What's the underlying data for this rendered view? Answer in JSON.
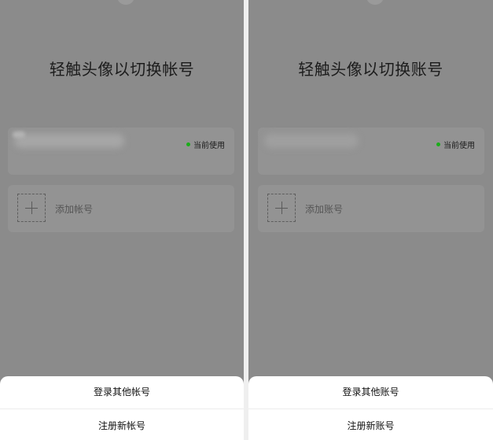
{
  "colors": {
    "overlay": "#8b8b8b",
    "card": "#939393",
    "gap": "#efefef",
    "sheet": "#ffffff",
    "status_dot": "#1aad19",
    "text": "#1c1c1c"
  },
  "icons": {
    "add": "plus-icon",
    "status": "green-dot-icon"
  },
  "panels": [
    {
      "title": "轻触头像以切换帐号",
      "current_status": "当前使用",
      "add_account": "添加帐号",
      "sheet": {
        "login_other": "登录其他帐号",
        "register_new": "注册新帐号"
      }
    },
    {
      "title": "轻触头像以切换账号",
      "current_status": "当前使用",
      "add_account": "添加账号",
      "sheet": {
        "login_other": "登录其他账号",
        "register_new": "注册新账号"
      }
    }
  ]
}
